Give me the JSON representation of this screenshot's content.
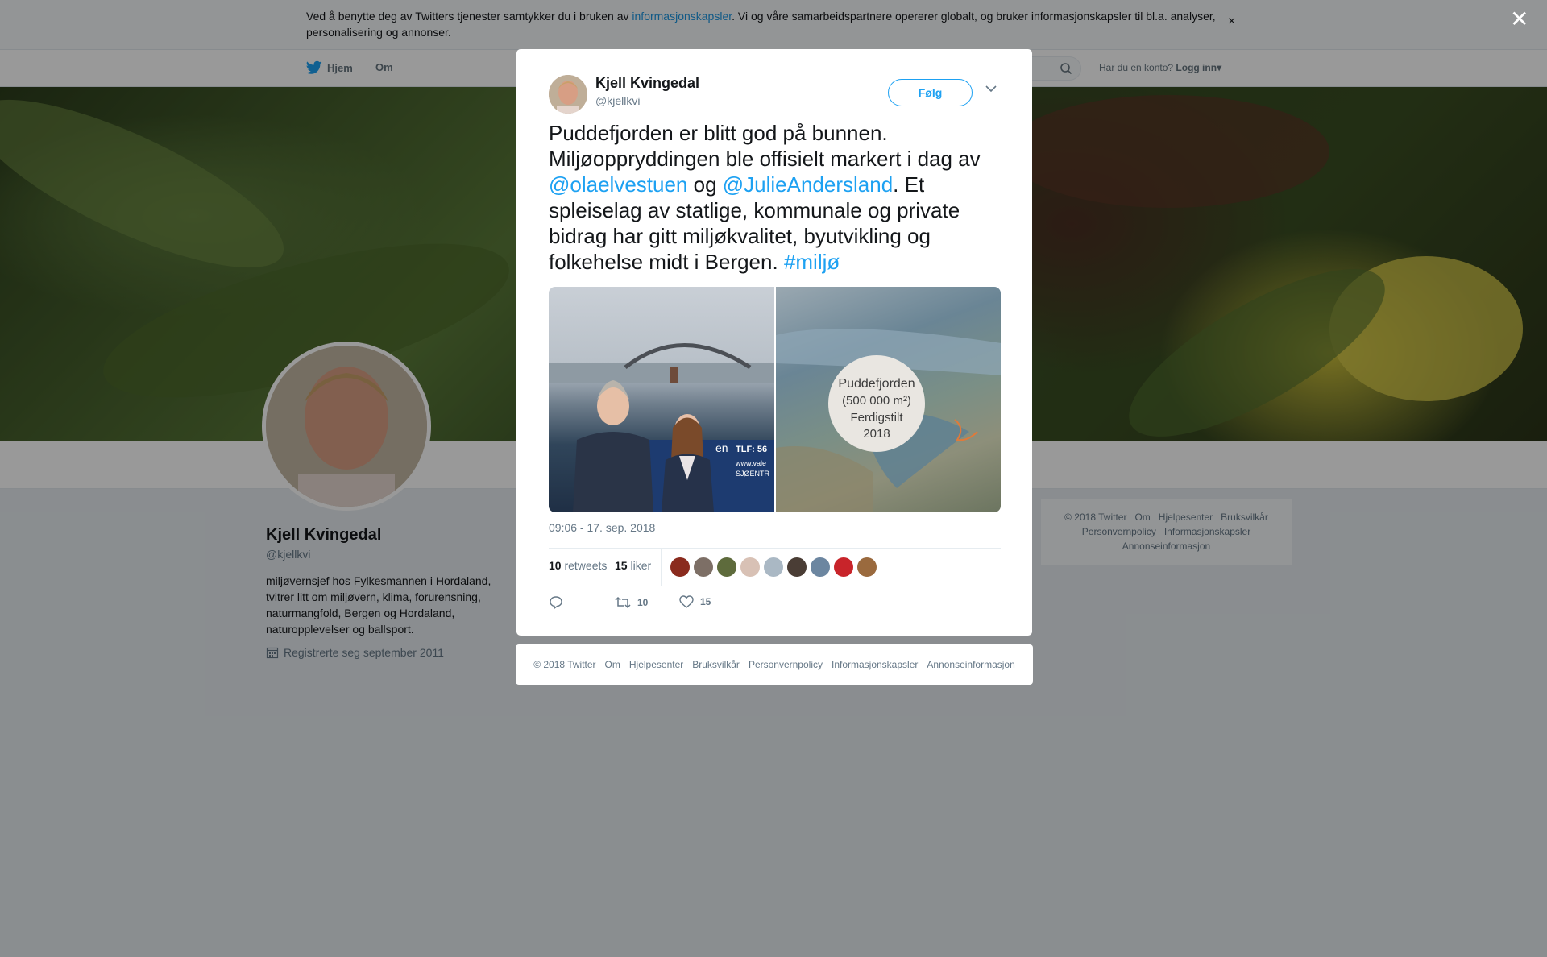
{
  "cookie_banner": {
    "text_before": "Ved å benytte deg av Twitters tjenester samtykker du i bruken av ",
    "link": "informasjonskapsler",
    "text_after": ". Vi og våre samarbeidspartnere opererer globalt, og bruker informasjonskapsler til bl.a. analyser, personalisering og annonser.",
    "close_icon": "×"
  },
  "nav": {
    "home": "Hjem",
    "about": "Om",
    "account_prompt": "Har du en konto?",
    "login": "Logg inn"
  },
  "profile": {
    "name": "Kjell Kvingedal",
    "handle": "@kjellkvi",
    "bio": "miljøvernsjef hos Fylkesmannen i Hordaland, tvitrer litt om miljøvern, klima, forurensning, naturmangfold, Bergen og Hordaland, naturopplevelser og ballsport.",
    "joined": "Registrerte seg september 2011"
  },
  "side_footer": [
    "© 2018 Twitter",
    "Om",
    "Hjelpesenter",
    "Bruksvilkår",
    "Personvernpolicy",
    "Informasjonskapsler",
    "Annonseinformasjon"
  ],
  "overlay_close": "✕",
  "tweet": {
    "author_name": "Kjell Kvingedal",
    "author_handle": "@kjellkvi",
    "follow_label": "Følg",
    "text_part1": "Puddefjorden er blitt god på bunnen. Miljøoppryddingen ble offisielt markert i dag av ",
    "mention1": "@olaelvestuen",
    "text_part2": " og ",
    "mention2": "@JulieAndersland",
    "text_part3": ". Et spleiselag av statlige, kommunale og private bidrag har gitt miljøkvalitet, byutvikling og folkehelse midt i Bergen. ",
    "hashtag": "#miljø",
    "photo1_sign_line1": "TLF: 56",
    "photo1_sign_line2": "www.vale",
    "photo1_sign_line3": "SJØENTR",
    "photo1_sign_brand": "en",
    "photo2_caption_line1": "Puddefjorden",
    "photo2_caption_line2": "(500 000 m²)",
    "photo2_caption_line3": "Ferdigstilt",
    "photo2_caption_line4": "2018",
    "timestamp": "09:06 - 17. sep. 2018",
    "retweet_count": "10",
    "retweet_label": "retweets",
    "like_count": "15",
    "like_label": "liker",
    "action_retweet_count": "10",
    "action_like_count": "15"
  },
  "liker_colors": [
    "#8a2b1e",
    "#7d6f66",
    "#5e6b3c",
    "#d8c1b5",
    "#aab8c4",
    "#4a3d35",
    "#6c86a0",
    "#c8242a",
    "#9a6a3e"
  ],
  "modal_footer": [
    "© 2018 Twitter",
    "Om",
    "Hjelpesenter",
    "Bruksvilkår",
    "Personvernpolicy",
    "Informasjonskapsler",
    "Annonseinformasjon"
  ],
  "colors": {
    "accent": "#1da1f2",
    "link": "#1b95e0",
    "secondary_text": "#657786"
  }
}
